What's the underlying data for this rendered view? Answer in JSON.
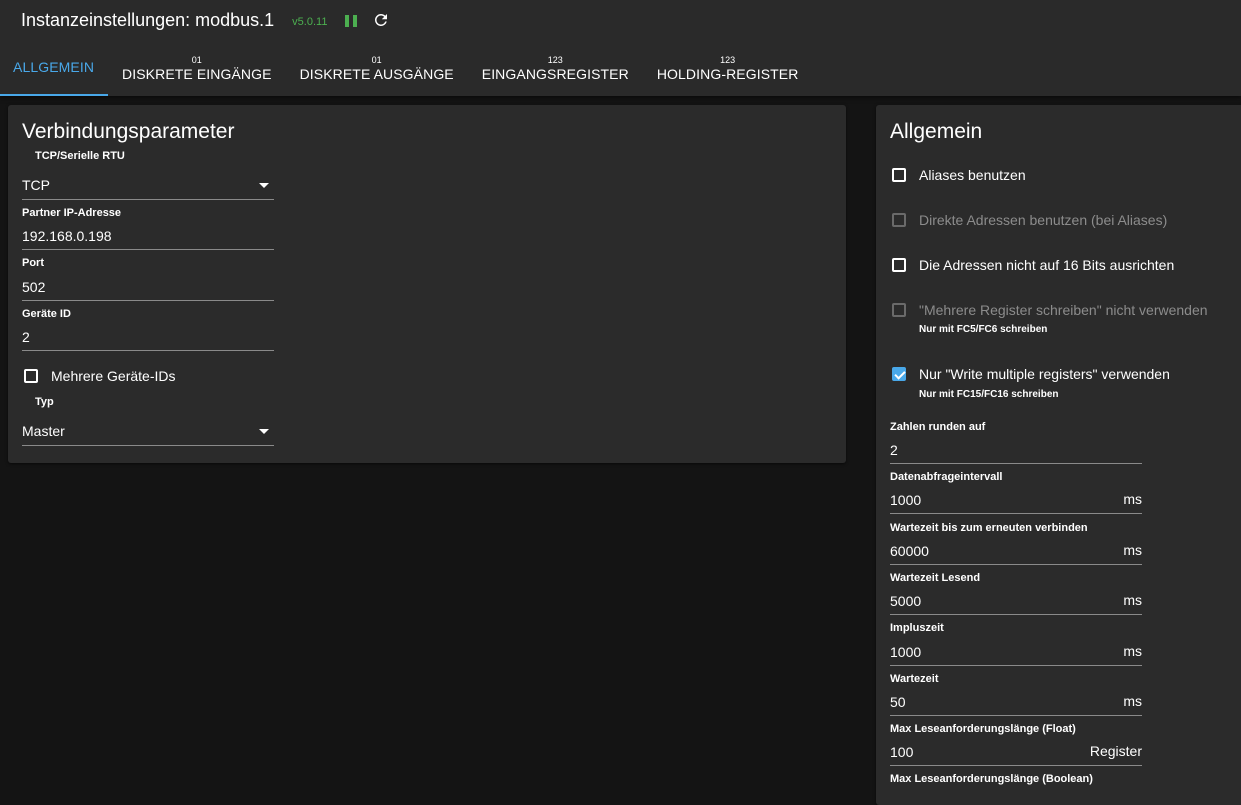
{
  "header": {
    "title": "Instanzeinstellungen: modbus.1",
    "version": "v5.0.11",
    "accent_color": "#4caf50",
    "pause_icon": "pause-icon",
    "reload_icon": "reload-icon"
  },
  "tabs": [
    {
      "label": "ALLGEMEIN",
      "sub": "",
      "active": true
    },
    {
      "label": "DISKRETE EINGÄNGE",
      "sub": "01"
    },
    {
      "label": "DISKRETE AUSGÄNGE",
      "sub": "01"
    },
    {
      "label": "EINGANGSREGISTER",
      "sub": "123"
    },
    {
      "label": "HOLDING-REGISTER",
      "sub": "123"
    }
  ],
  "left": {
    "title": "Verbindungsparameter",
    "connection_type": {
      "label": "TCP/Serielle RTU",
      "value": "TCP"
    },
    "ip": {
      "label": "Partner IP-Adresse",
      "value": "192.168.0.198"
    },
    "port": {
      "label": "Port",
      "value": "502"
    },
    "device_id": {
      "label": "Geräte ID",
      "value": "2"
    },
    "multi_ids": {
      "label": "Mehrere Geräte-IDs",
      "checked": false
    },
    "type": {
      "label": "Typ",
      "value": "Master"
    }
  },
  "right": {
    "title": "Allgemein",
    "options": [
      {
        "label": "Aliases benutzen",
        "checked": false,
        "disabled": false
      },
      {
        "label": "Direkte Adressen benutzen (bei Aliases)",
        "checked": false,
        "disabled": true
      },
      {
        "label": "Die Adressen nicht auf 16 Bits ausrichten",
        "checked": false,
        "disabled": false
      },
      {
        "label": "\"Mehrere Register schreiben\" nicht verwenden",
        "help": "Nur mit FC5/FC6 schreiben",
        "checked": false,
        "disabled": true
      },
      {
        "label": "Nur \"Write multiple registers\" verwenden",
        "help": "Nur mit FC15/FC16 schreiben",
        "checked": true,
        "disabled": false
      }
    ],
    "fields": [
      {
        "label": "Zahlen runden auf",
        "value": "2",
        "unit": ""
      },
      {
        "label": "Datenabfrageintervall",
        "value": "1000",
        "unit": "ms"
      },
      {
        "label": "Wartezeit bis zum erneuten verbinden",
        "value": "60000",
        "unit": "ms"
      },
      {
        "label": "Wartezeit Lesend",
        "value": "5000",
        "unit": "ms"
      },
      {
        "label": "Impluszeit",
        "value": "1000",
        "unit": "ms"
      },
      {
        "label": "Wartezeit",
        "value": "50",
        "unit": "ms"
      },
      {
        "label": "Max Leseanforderungslänge (Float)",
        "value": "100",
        "unit": "Register"
      },
      {
        "label": "Max Leseanforderungslänge (Boolean)",
        "value": "",
        "unit": ""
      }
    ]
  }
}
